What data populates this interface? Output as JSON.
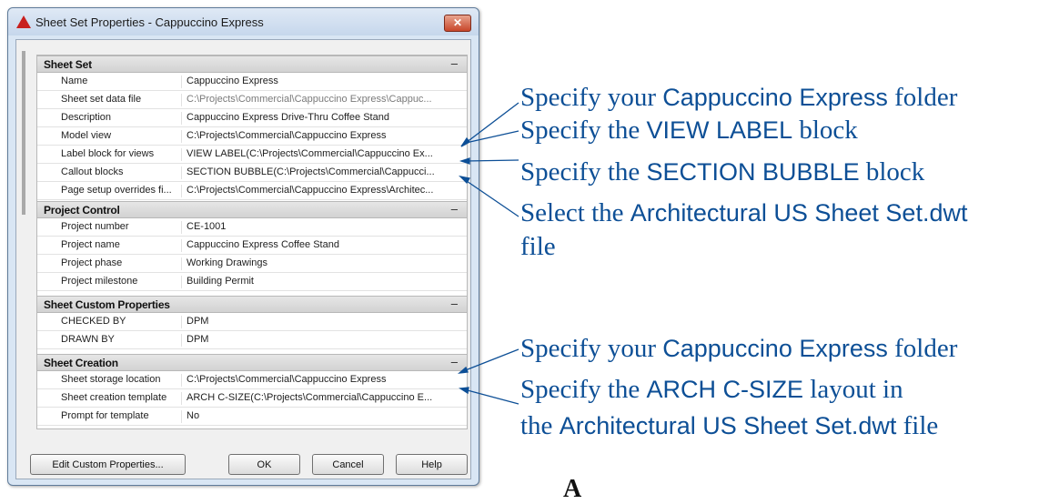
{
  "window": {
    "title": "Sheet Set Properties - Cappuccino Express",
    "close_label": "✕"
  },
  "categories": [
    {
      "title": "Sheet Set",
      "toggle": "–",
      "rows": [
        {
          "name": "Name",
          "value": "Cappuccino Express"
        },
        {
          "name": "Sheet set data file",
          "value": "C:\\Projects\\Commercial\\Cappuccino Express\\Cappuc..."
        },
        {
          "name": "Description",
          "value": "Cappuccino Express Drive-Thru Coffee Stand"
        },
        {
          "name": "Model view",
          "value": "C:\\Projects\\Commercial\\Cappuccino Express"
        },
        {
          "name": "Label block for views",
          "value": "VIEW LABEL(C:\\Projects\\Commercial\\Cappuccino Ex..."
        },
        {
          "name": "Callout blocks",
          "value": "SECTION BUBBLE(C:\\Projects\\Commercial\\Cappucci..."
        },
        {
          "name": "Page setup overrides fi...",
          "value": "C:\\Projects\\Commercial\\Cappuccino Express\\Architec..."
        }
      ]
    },
    {
      "title": "Project Control",
      "toggle": "–",
      "rows": [
        {
          "name": "Project number",
          "value": "CE-1001"
        },
        {
          "name": "Project name",
          "value": "Cappuccino Express Coffee Stand"
        },
        {
          "name": "Project phase",
          "value": "Working Drawings"
        },
        {
          "name": "Project milestone",
          "value": "Building Permit"
        }
      ]
    },
    {
      "title": "Sheet Custom Properties",
      "toggle": "–",
      "rows": [
        {
          "name": "CHECKED BY",
          "value": "DPM"
        },
        {
          "name": "DRAWN BY",
          "value": "DPM"
        }
      ]
    },
    {
      "title": "Sheet Creation",
      "toggle": "–",
      "rows": [
        {
          "name": "Sheet storage location",
          "value": "C:\\Projects\\Commercial\\Cappuccino Express"
        },
        {
          "name": "Sheet creation template",
          "value": "ARCH C-SIZE(C:\\Projects\\Commercial\\Cappuccino E..."
        },
        {
          "name": "Prompt for template",
          "value": "No"
        }
      ]
    }
  ],
  "buttons": {
    "edit_custom": "Edit Custom Properties...",
    "ok": "OK",
    "cancel": "Cancel",
    "help": "Help"
  },
  "callouts": [
    {
      "a": "Specify your ",
      "b": "Cappuccino Express",
      "c": " folder"
    },
    {
      "a": "Specify the ",
      "b": "VIEW LABEL",
      "c": " block"
    },
    {
      "a": "Specify the ",
      "b": "SECTION BUBBLE",
      "c": " block"
    },
    {
      "a": "Select the ",
      "b": "Architectural US Sheet Set.dwt",
      "c": ""
    },
    {
      "a": "file",
      "b": "",
      "c": ""
    },
    {
      "a": "Specify your ",
      "b": "Cappuccino Express",
      "c": " folder"
    },
    {
      "a": "Specify the ",
      "b": "ARCH C-SIZE",
      "c": " layout in"
    },
    {
      "a": "the ",
      "b": "Architectural US Sheet Set.dwt",
      "c": " file"
    }
  ],
  "figure_label": "A",
  "colors": {
    "callout_text": "#0d4f96",
    "title_icon": "#c8201e",
    "close_button": "#c8462a"
  }
}
